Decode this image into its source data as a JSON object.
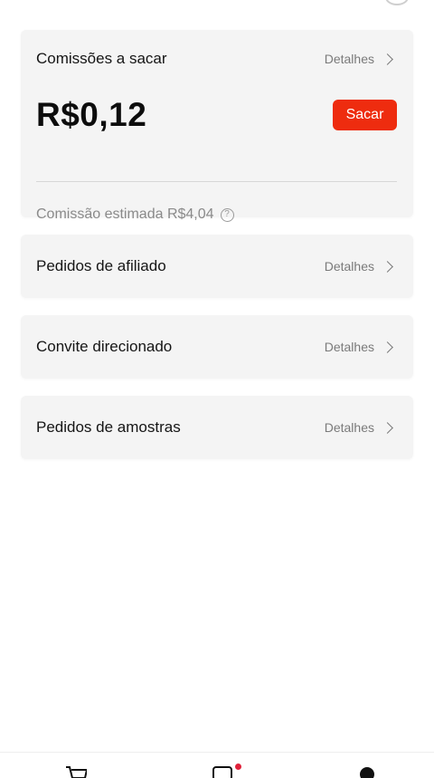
{
  "commissions_card": {
    "title": "Comissões a sacar",
    "details_label": "Detalhes",
    "amount": "R$0,12",
    "withdraw_label": "Sacar",
    "estimate_text": "Comissão estimada R$4,04",
    "help_icon": "?"
  },
  "rows": [
    {
      "title": "Pedidos de afiliado",
      "details_label": "Detalhes"
    },
    {
      "title": "Convite direcionado",
      "details_label": "Detalhes"
    },
    {
      "title": "Pedidos de amostras",
      "details_label": "Detalhes"
    }
  ],
  "bottom_nav": {
    "items": [
      "cart-icon",
      "shop-icon",
      "profile-icon"
    ],
    "notification_color": "#e0213a"
  },
  "colors": {
    "accent": "#ee2c0f",
    "card_bg": "#f4f4f4"
  }
}
